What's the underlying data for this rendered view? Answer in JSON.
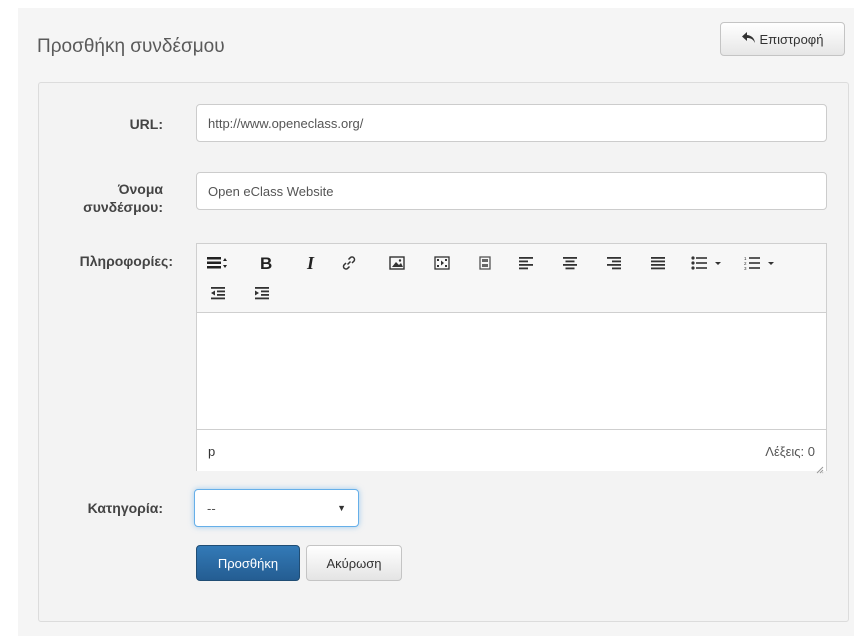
{
  "page": {
    "title": "Προσθήκη συνδέσμου",
    "back_label": "Επιστροφή"
  },
  "form": {
    "url": {
      "label": "URL:",
      "value": "http://www.openeclass.org/"
    },
    "link_name": {
      "label_line1": "Όνομα",
      "label_line2": "συνδέσμου:",
      "value": "Open eClass Website"
    },
    "info": {
      "label": "Πληροφορίες:",
      "toolbar": [
        "format-select-icon",
        "bold-icon",
        "italic-icon",
        "link-icon",
        "image-icon",
        "media-icon",
        "video-icon",
        "align-left-icon",
        "align-center-icon",
        "align-right-icon",
        "align-justify-icon",
        "bullet-list-icon",
        "numbered-list-icon",
        "outdent-icon",
        "indent-icon"
      ],
      "status_path": "p",
      "word_count": "Λέξεις: 0"
    },
    "category": {
      "label": "Κατηγορία:",
      "selected": "--"
    },
    "submit_label": "Προσθήκη",
    "cancel_label": "Ακύρωση"
  },
  "colors": {
    "primary": "#337ab7",
    "panel_bg": "#f3f3f3",
    "focus": "#66afe9"
  }
}
